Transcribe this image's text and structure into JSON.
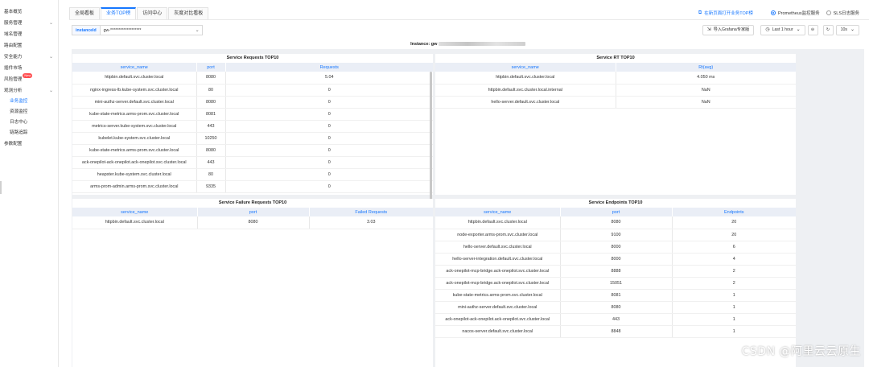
{
  "sidebar": {
    "items": [
      {
        "label": "基本概览",
        "chevron": false,
        "sub": false,
        "active": false
      },
      {
        "label": "服务管理",
        "chevron": true,
        "sub": false,
        "active": false
      },
      {
        "label": "域名管理",
        "chevron": false,
        "sub": false,
        "active": false
      },
      {
        "label": "路由配置",
        "chevron": false,
        "sub": false,
        "active": false
      },
      {
        "label": "安全能力",
        "chevron": true,
        "sub": false,
        "active": false
      },
      {
        "label": "插件市场",
        "chevron": false,
        "sub": false,
        "active": false
      },
      {
        "label": "风险管理",
        "chevron": false,
        "sub": false,
        "active": false,
        "badge": "New"
      },
      {
        "label": "观测分析",
        "chevron": true,
        "sub": false,
        "active": false
      },
      {
        "label": "业务监控",
        "chevron": false,
        "sub": true,
        "active": true
      },
      {
        "label": "资源监控",
        "chevron": false,
        "sub": true,
        "active": false
      },
      {
        "label": "日志中心",
        "chevron": false,
        "sub": true,
        "active": false
      },
      {
        "label": "链路追踪",
        "chevron": false,
        "sub": true,
        "active": false
      },
      {
        "label": "参数配置",
        "chevron": false,
        "sub": false,
        "active": false
      }
    ]
  },
  "tabs": [
    {
      "label": "全局看板",
      "active": false
    },
    {
      "label": "业务TOP榜",
      "active": true
    },
    {
      "label": "访问中心",
      "active": false
    },
    {
      "label": "灰度对比看板",
      "active": false
    }
  ],
  "header": {
    "ext_link": "在新页面打开业务TOP榜",
    "radio_prometheus": "Prometheus监控服务",
    "radio_sls": "SLS日志服务"
  },
  "filter": {
    "label": "instanceId",
    "value": "gw-*******************"
  },
  "toolbar": {
    "grafana_label": "导入Grafana专家版",
    "time_range": "Last 1 hour",
    "refresh": "10s"
  },
  "instance_title": "Instance: gw",
  "panels": {
    "requests": {
      "title": "Service Requests TOP10",
      "headers": [
        "service_name",
        "port",
        "Requests"
      ],
      "rows": [
        [
          "httpbin.default.svc.cluster.local",
          "8080",
          "5.04"
        ],
        [
          "nginx-ingress-lb.kube-system.svc.cluster.local",
          "80",
          "0"
        ],
        [
          "mini-authz-server.default.svc.cluster.local",
          "8080",
          "0"
        ],
        [
          "kube-state-metrics.arms-prom.svc.cluster.local",
          "8081",
          "0"
        ],
        [
          "metrics-server.kube-system.svc.cluster.local",
          "443",
          "0"
        ],
        [
          "kubelet.kube-system.svc.cluster.local",
          "10250",
          "0"
        ],
        [
          "kube-state-metrics.arms-prom.svc.cluster.local",
          "8080",
          "0"
        ],
        [
          "ack-onepilot-ack-onepilot.ack-onepilot.svc.cluster.local",
          "443",
          "0"
        ],
        [
          "heapster.kube-system.svc.cluster.local",
          "80",
          "0"
        ],
        [
          "arms-prom-admin.arms-prom.svc.cluster.local",
          "9335",
          "0"
        ]
      ]
    },
    "rt": {
      "title": "Service RT TOP10",
      "headers": [
        "service_name",
        "Rt(avg)"
      ],
      "rows": [
        [
          "httpbin.default.svc.cluster.local",
          "4.050 ms"
        ],
        [
          "httpbin.default.svc.cluster.local.internal",
          "NaN"
        ],
        [
          "hello-server.default.svc.cluster.local",
          "NaN"
        ]
      ]
    },
    "failures": {
      "title": "Service Failure Requests TOP10",
      "headers": [
        "service_name",
        "port",
        "Failed Requests"
      ],
      "rows": [
        [
          "httpbin.default.svc.cluster.local",
          "8080",
          "3.03"
        ]
      ]
    },
    "endpoints": {
      "title": "Service Endpoints TOP10",
      "headers": [
        "service_name",
        "port",
        "Endpoints"
      ],
      "rows": [
        [
          "httpbin.default.svc.cluster.local",
          "8080",
          "20"
        ],
        [
          "node-exporter.arms-prom.svc.cluster.local",
          "9100",
          "20"
        ],
        [
          "hello-server.default.svc.cluster.local",
          "8000",
          "6"
        ],
        [
          "hello-server-integration.default.svc.cluster.local",
          "8000",
          "4"
        ],
        [
          "ack-onepilot-mcp-bridge.ack-onepilot.svc.cluster.local",
          "8888",
          "2"
        ],
        [
          "ack-onepilot-mcp-bridge.ack-onepilot.svc.cluster.local",
          "15051",
          "2"
        ],
        [
          "kube-state-metrics.arms-prom.svc.cluster.local",
          "8081",
          "1"
        ],
        [
          "mini-authz-server.default.svc.cluster.local",
          "8080",
          "1"
        ],
        [
          "ack-onepilot-ack-onepilot.ack-onepilot.svc.cluster.local",
          "443",
          "1"
        ],
        [
          "nacos-server.default.svc.cluster.local",
          "8848",
          "1"
        ]
      ]
    }
  },
  "watermark": "CSDN @阿里云云原生",
  "colors": {
    "accent": "#1677ff",
    "header_bg": "#eaeef6",
    "content_bg": "#eef0f3",
    "badge": "#ff4d4f"
  }
}
